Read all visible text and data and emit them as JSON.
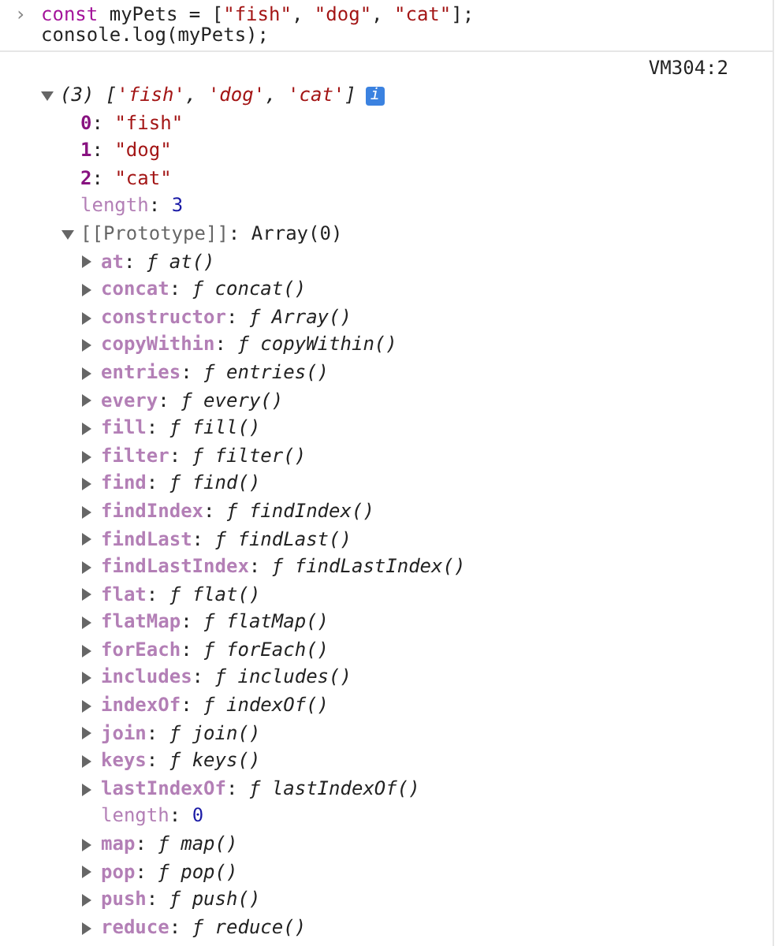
{
  "input": {
    "prompt": "›",
    "lines": [
      [
        {
          "text": "const",
          "kind": "keyword"
        },
        {
          "text": " myPets = [",
          "kind": "plain"
        },
        {
          "text": "\"fish\"",
          "kind": "string"
        },
        {
          "text": ", ",
          "kind": "plain"
        },
        {
          "text": "\"dog\"",
          "kind": "string"
        },
        {
          "text": ", ",
          "kind": "plain"
        },
        {
          "text": "\"cat\"",
          "kind": "string"
        },
        {
          "text": "];",
          "kind": "plain"
        }
      ],
      [
        {
          "text": "console.log(myPets);",
          "kind": "plain"
        }
      ]
    ]
  },
  "source_link": "VM304:2",
  "log": {
    "expanded": true,
    "summary": [
      {
        "text": "(3) [",
        "kind": "plain"
      },
      {
        "text": "'fish'",
        "kind": "string"
      },
      {
        "text": ", ",
        "kind": "plain"
      },
      {
        "text": "'dog'",
        "kind": "string"
      },
      {
        "text": ", ",
        "kind": "plain"
      },
      {
        "text": "'cat'",
        "kind": "string"
      },
      {
        "text": "]",
        "kind": "plain"
      }
    ],
    "info_badge": "i",
    "children": [
      {
        "key": "0",
        "sep": ":",
        "value": "\"fish\"",
        "kind": "index"
      },
      {
        "key": "1",
        "sep": ":",
        "value": "\"dog\"",
        "kind": "index"
      },
      {
        "key": "2",
        "sep": ":",
        "value": "\"cat\"",
        "kind": "index"
      },
      {
        "key": "length",
        "sep": ":",
        "value": "3",
        "kind": "hidden"
      },
      {
        "key": "[[Prototype]]",
        "sep": ":",
        "value": "Array(0)",
        "kind": "internal",
        "expanded": true,
        "children": [
          {
            "key": "at",
            "sep": ":",
            "value": "ƒ at()",
            "kind": "method",
            "expanded": false
          },
          {
            "key": "concat",
            "sep": ":",
            "value": "ƒ concat()",
            "kind": "method",
            "expanded": false
          },
          {
            "key": "constructor",
            "sep": ":",
            "value": "ƒ Array()",
            "kind": "method",
            "expanded": false
          },
          {
            "key": "copyWithin",
            "sep": ":",
            "value": "ƒ copyWithin()",
            "kind": "method",
            "expanded": false
          },
          {
            "key": "entries",
            "sep": ":",
            "value": "ƒ entries()",
            "kind": "method",
            "expanded": false
          },
          {
            "key": "every",
            "sep": ":",
            "value": "ƒ every()",
            "kind": "method",
            "expanded": false
          },
          {
            "key": "fill",
            "sep": ":",
            "value": "ƒ fill()",
            "kind": "method",
            "expanded": false
          },
          {
            "key": "filter",
            "sep": ":",
            "value": "ƒ filter()",
            "kind": "method",
            "expanded": false
          },
          {
            "key": "find",
            "sep": ":",
            "value": "ƒ find()",
            "kind": "method",
            "expanded": false
          },
          {
            "key": "findIndex",
            "sep": ":",
            "value": "ƒ findIndex()",
            "kind": "method",
            "expanded": false
          },
          {
            "key": "findLast",
            "sep": ":",
            "value": "ƒ findLast()",
            "kind": "method",
            "expanded": false
          },
          {
            "key": "findLastIndex",
            "sep": ":",
            "value": "ƒ findLastIndex()",
            "kind": "method",
            "expanded": false
          },
          {
            "key": "flat",
            "sep": ":",
            "value": "ƒ flat()",
            "kind": "method",
            "expanded": false
          },
          {
            "key": "flatMap",
            "sep": ":",
            "value": "ƒ flatMap()",
            "kind": "method",
            "expanded": false
          },
          {
            "key": "forEach",
            "sep": ":",
            "value": "ƒ forEach()",
            "kind": "method",
            "expanded": false
          },
          {
            "key": "includes",
            "sep": ":",
            "value": "ƒ includes()",
            "kind": "method",
            "expanded": false
          },
          {
            "key": "indexOf",
            "sep": ":",
            "value": "ƒ indexOf()",
            "kind": "method",
            "expanded": false
          },
          {
            "key": "join",
            "sep": ":",
            "value": "ƒ join()",
            "kind": "method",
            "expanded": false
          },
          {
            "key": "keys",
            "sep": ":",
            "value": "ƒ keys()",
            "kind": "method",
            "expanded": false
          },
          {
            "key": "lastIndexOf",
            "sep": ":",
            "value": "ƒ lastIndexOf()",
            "kind": "method",
            "expanded": false
          },
          {
            "key": "length",
            "sep": ":",
            "value": "0",
            "kind": "hidden"
          },
          {
            "key": "map",
            "sep": ":",
            "value": "ƒ map()",
            "kind": "method",
            "expanded": false
          },
          {
            "key": "pop",
            "sep": ":",
            "value": "ƒ pop()",
            "kind": "method",
            "expanded": false
          },
          {
            "key": "push",
            "sep": ":",
            "value": "ƒ push()",
            "kind": "method",
            "expanded": false
          },
          {
            "key": "reduce",
            "sep": ":",
            "value": "ƒ reduce()",
            "kind": "method",
            "expanded": false
          }
        ]
      }
    ]
  }
}
